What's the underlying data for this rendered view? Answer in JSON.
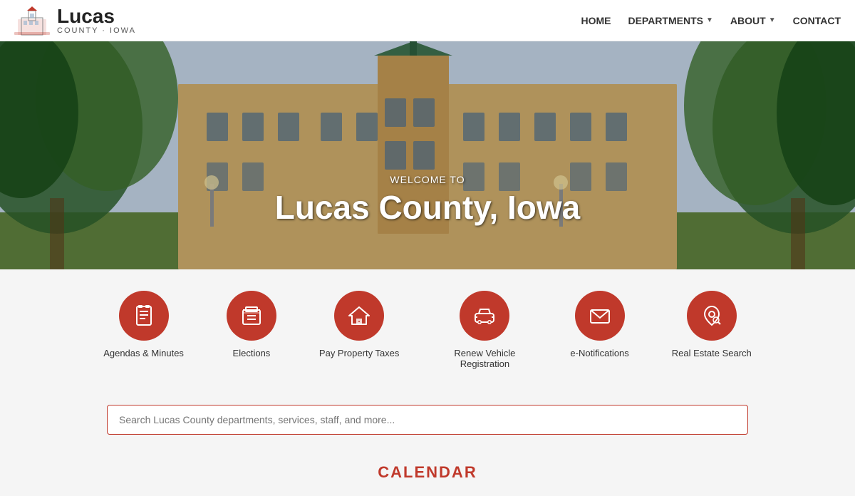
{
  "header": {
    "logo_title": "Lucas",
    "logo_subtitle": "COUNTY · IOWA",
    "nav": {
      "home": "HOME",
      "departments": "DEPARTMENTS",
      "about": "ABOUT",
      "contact": "CONTACT"
    }
  },
  "hero": {
    "welcome_text": "WELCOME TO",
    "title": "Lucas County, Iowa"
  },
  "quick_links": [
    {
      "id": "agendas",
      "label": "Agendas & Minutes",
      "icon": "document"
    },
    {
      "id": "elections",
      "label": "Elections",
      "icon": "ballot"
    },
    {
      "id": "taxes",
      "label": "Pay Property Taxes",
      "icon": "house"
    },
    {
      "id": "vehicle",
      "label": "Renew Vehicle Registration",
      "icon": "car"
    },
    {
      "id": "notifications",
      "label": "e-Notifications",
      "icon": "email"
    },
    {
      "id": "realestate",
      "label": "Real Estate Search",
      "icon": "map-search"
    }
  ],
  "search": {
    "placeholder": "Search Lucas County departments, services, staff, and more..."
  },
  "calendar": {
    "title": "CALENDAR"
  },
  "colors": {
    "red": "#c0392b",
    "nav_text": "#333",
    "hero_bg": "#5a6a4a"
  }
}
